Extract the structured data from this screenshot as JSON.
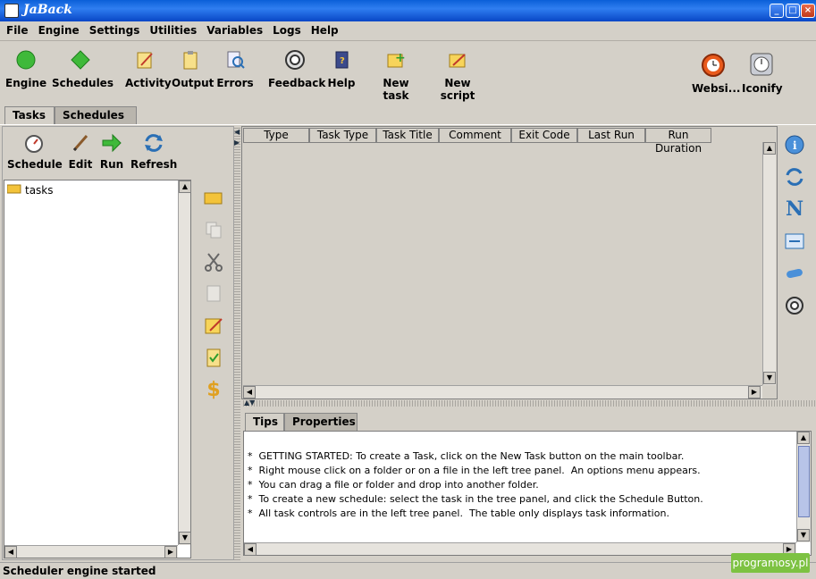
{
  "window": {
    "title": "JaBack"
  },
  "menu": [
    "File",
    "Engine",
    "Settings",
    "Utilities",
    "Variables",
    "Logs",
    "Help"
  ],
  "toolbar": {
    "engine": "Engine",
    "schedules": "Schedules",
    "activity": "Activity",
    "output": "Output",
    "errors": "Errors",
    "feedback": "Feedback",
    "help": "Help",
    "new_task": "New task",
    "new_script": "New script",
    "website": "Websi...",
    "iconify": "Iconify"
  },
  "main_tabs": [
    "Tasks",
    "Schedules"
  ],
  "task_toolbar": {
    "schedule": "Schedule",
    "edit": "Edit",
    "run": "Run",
    "refresh": "Refresh"
  },
  "tree": {
    "root": "tasks"
  },
  "table": {
    "columns": [
      "Type",
      "Task Type",
      "Task Title",
      "Comment",
      "Exit Code",
      "Last Run",
      "Run Duration"
    ]
  },
  "bottom_tabs": [
    "Tips",
    "Properties"
  ],
  "tips": [
    "*  GETTING STARTED: To create a Task, click on the New Task button on the main toolbar.",
    "*  Right mouse click on a folder or on a file in the left tree panel.  An options menu appears.",
    "*  You can drag a file or folder and drop into another folder.",
    "*  To create a new schedule: select the task in the tree panel, and click the Schedule Button.",
    "*  All task controls are in the left tree panel.  The table only displays task information."
  ],
  "status": "Scheduler engine started",
  "watermark": "programosy.pl",
  "colors": {
    "titlebar": "#0a5fd8",
    "window_bg": "#d4d0c8",
    "watermark_bg": "#7dc242"
  }
}
